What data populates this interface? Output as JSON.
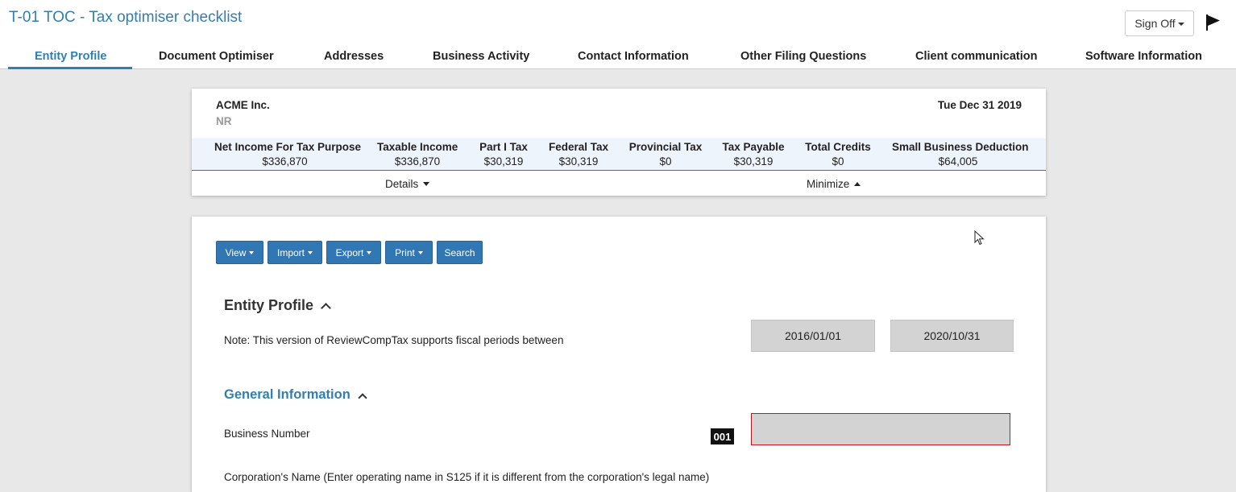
{
  "header": {
    "title": "T-01 TOC - Tax optimiser checklist",
    "sign_off_label": "Sign Off",
    "flag_icon": "flag-icon"
  },
  "tabs": [
    {
      "label": "Entity Profile",
      "active": true
    },
    {
      "label": "Document Optimiser"
    },
    {
      "label": "Addresses"
    },
    {
      "label": "Business Activity"
    },
    {
      "label": "Contact Information"
    },
    {
      "label": "Other Filing Questions"
    },
    {
      "label": "Client communication"
    },
    {
      "label": "Software Information"
    }
  ],
  "summary": {
    "company": "ACME Inc.",
    "type": "NR",
    "period_end": "Tue Dec 31 2019",
    "metrics": [
      {
        "label": "Net Income For Tax Purpose",
        "value": "$336,870"
      },
      {
        "label": "Taxable Income",
        "value": "$336,870"
      },
      {
        "label": "Part I Tax",
        "value": "$30,319"
      },
      {
        "label": "Federal Tax",
        "value": "$30,319"
      },
      {
        "label": "Provincial Tax",
        "value": "$0"
      },
      {
        "label": "Tax Payable",
        "value": "$30,319"
      },
      {
        "label": "Total Credits",
        "value": "$0"
      },
      {
        "label": "Small Business Deduction",
        "value": "$64,005"
      }
    ],
    "details_label": "Details",
    "minimize_label": "Minimize"
  },
  "toolbar": {
    "view": "View",
    "import": "Import",
    "export": "Export",
    "print": "Print",
    "search": "Search"
  },
  "entity_profile": {
    "title": "Entity Profile",
    "note": "Note: This version of ReviewCompTax supports fiscal periods between",
    "period_start": "2016/01/01",
    "period_end": "2020/10/31"
  },
  "general_info": {
    "title": "General Information",
    "business_number_label": "Business Number",
    "business_number_code": "001",
    "business_number_value": "",
    "corp_name_label": "Corporation's Name (Enter operating name in S125 if it is different from the corporation's legal name)"
  },
  "colors": {
    "accent": "#2f7fb5",
    "button": "#3077b4",
    "error_border": "#c21818"
  }
}
